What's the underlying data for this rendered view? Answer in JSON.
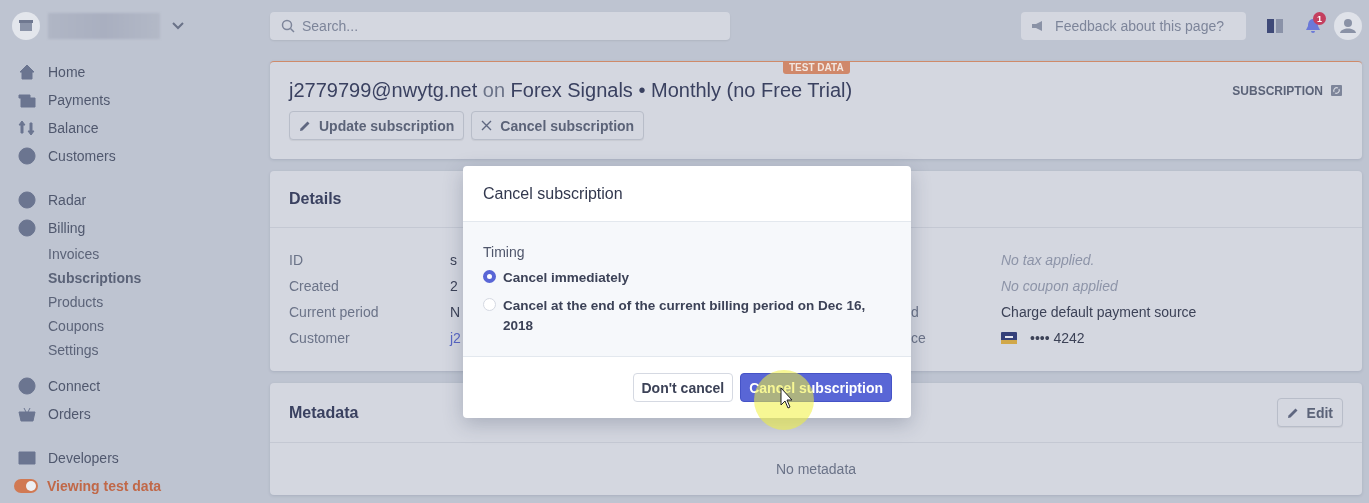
{
  "sidebar": {
    "sections": [
      {
        "items": [
          {
            "label": "Home",
            "selected": false
          },
          {
            "label": "Payments",
            "selected": false
          },
          {
            "label": "Balance",
            "selected": false
          },
          {
            "label": "Customers",
            "selected": false
          }
        ]
      },
      {
        "items": [
          {
            "label": "Radar",
            "selected": false
          },
          {
            "label": "Billing",
            "selected": false,
            "children": [
              {
                "label": "Invoices",
                "selected": false
              },
              {
                "label": "Subscriptions",
                "selected": true
              },
              {
                "label": "Products",
                "selected": false
              },
              {
                "label": "Coupons",
                "selected": false
              },
              {
                "label": "Settings",
                "selected": false
              }
            ]
          }
        ]
      },
      {
        "items": [
          {
            "label": "Connect",
            "selected": false
          },
          {
            "label": "Orders",
            "selected": false
          }
        ]
      },
      {
        "items": [
          {
            "label": "Developers",
            "selected": false
          }
        ]
      }
    ],
    "test_toggle": {
      "label": "Viewing test data",
      "on": true
    }
  },
  "topbar": {
    "search": {
      "placeholder": "Search..."
    },
    "feedback": "Feedback about this page?",
    "notification_count": "1"
  },
  "header": {
    "badge": "TEST DATA",
    "email": "j2779799@nwytg.net",
    "connector": "on",
    "plan": "Forex Signals • Monthly (no Free Trial)",
    "type_label": "SUBSCRIPTION",
    "buttons": [
      {
        "label": "Update subscription",
        "kind": "edit"
      },
      {
        "label": "Cancel subscription",
        "kind": "cancel"
      }
    ]
  },
  "details": {
    "title": "Details",
    "rows": [
      {
        "label": "ID",
        "value": "s",
        "label_2": "",
        "value_2": "No tax applied.",
        "muted_2": true
      },
      {
        "label": "Created",
        "value": "2",
        "label_2": "",
        "value_2": "No coupon applied",
        "muted_2": true
      },
      {
        "label": "Current period",
        "value": "N",
        "label_2": "d",
        "value_2": "Charge default payment source",
        "muted_2": false
      },
      {
        "label": "Customer",
        "value": "j2",
        "link": true,
        "label_2": "ce",
        "value_2": "•••• 4242",
        "card": true,
        "muted_2": false
      }
    ]
  },
  "metadata": {
    "title": "Metadata",
    "edit": "Edit",
    "empty": "No metadata"
  },
  "modal": {
    "title": "Cancel subscription",
    "section": "Timing",
    "options": [
      {
        "label": "Cancel immediately",
        "selected": true
      },
      {
        "label": "Cancel at the end of the current billing period on Dec 16, 2018",
        "selected": false
      }
    ],
    "buttons": [
      {
        "label": "Don't cancel",
        "kind": "secondary"
      },
      {
        "label": "Cancel subscription",
        "kind": "primary"
      }
    ]
  }
}
